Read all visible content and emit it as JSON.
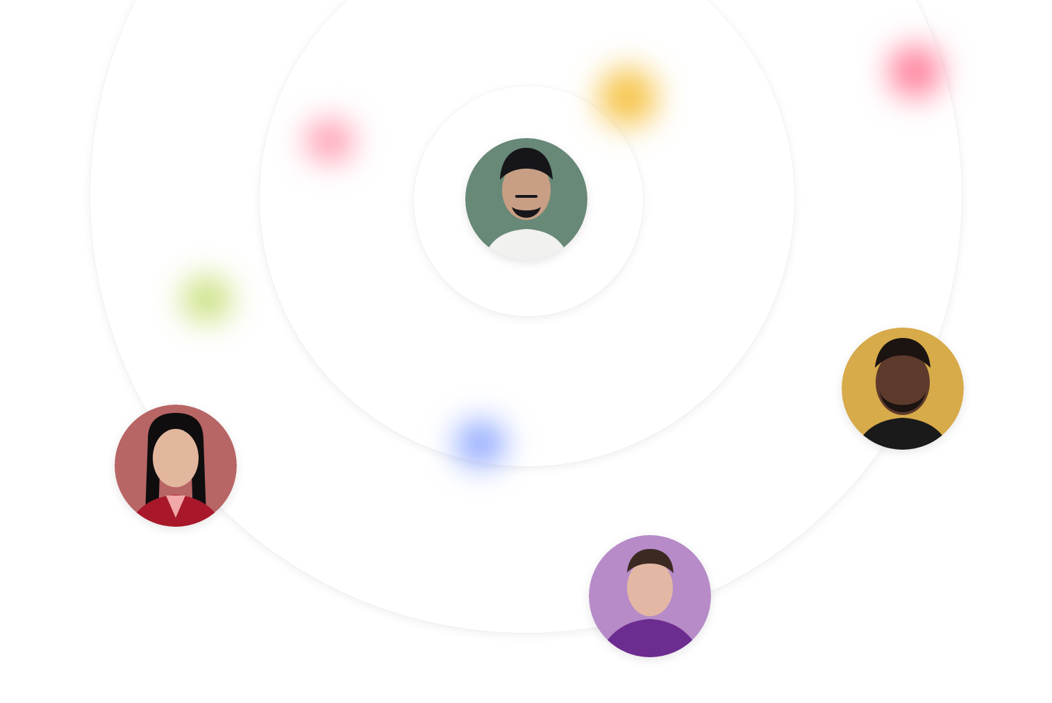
{
  "scene": {
    "rings": [
      "outer",
      "middle",
      "inner"
    ],
    "glow_blobs": [
      {
        "name": "yellow",
        "color": "#f6c44a"
      },
      {
        "name": "red",
        "color": "#ff7f9a"
      },
      {
        "name": "pink",
        "color": "#ff9bb0"
      },
      {
        "name": "green",
        "color": "#c9e07e"
      },
      {
        "name": "blue",
        "color": "#8ea7ff"
      }
    ],
    "avatars": [
      {
        "id": "center",
        "background": "#688878",
        "shirt": "#f1f1ef",
        "hair": "#16161a",
        "skin": "#c89f84",
        "accessory": "beanie"
      },
      {
        "id": "right",
        "background": "#d7aa4a",
        "shirt": "#1a1a1a",
        "hair": "#1b1411",
        "skin": "#5d3a2b",
        "accessory": "beard"
      },
      {
        "id": "left",
        "background": "#b86565",
        "shirt": "#a8182a",
        "hair": "#0f0d0e",
        "skin": "#e2b79d",
        "accessory": "long-hair"
      },
      {
        "id": "bottom",
        "background": "#b68bc8",
        "shirt": "#6d2c8f",
        "hair": "#3c2a22",
        "skin": "#e3b7a3",
        "accessory": "short-hair"
      }
    ]
  }
}
